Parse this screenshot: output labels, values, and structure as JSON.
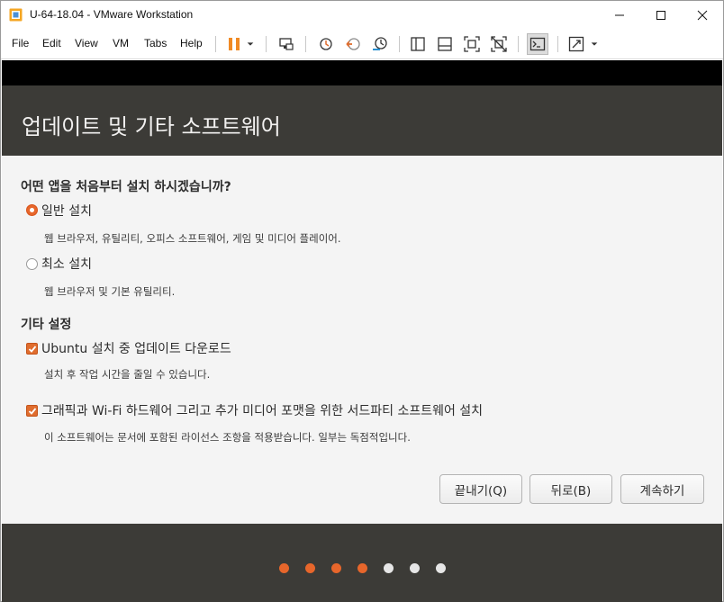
{
  "window": {
    "title": "U-64-18.04 - VMware Workstation"
  },
  "menu": {
    "items": [
      "File",
      "Edit",
      "View",
      "VM",
      "Tabs",
      "Help"
    ]
  },
  "toolbar": {
    "icons": [
      "pause-icon",
      "dropdown-arrow-icon",
      "send-ctrl-alt-del-icon",
      "snapshot-take-icon",
      "snapshot-revert-icon",
      "snapshot-manager-icon",
      "sidebar-library-icon",
      "thumbnail-bar-icon",
      "fullscreen-icon",
      "unity-icon",
      "console-view-icon",
      "stretch-guest-icon",
      "dropdown-arrow-icon"
    ]
  },
  "installer": {
    "title": "업데이트 및 기타 소프트웨어",
    "question": "어떤 앱을 처음부터 설치 하시겠습니까?",
    "options": [
      {
        "label": "일반 설치",
        "description": "웹 브라우저, 유틸리티, 오피스  소프트웨어, 게임 및 미디어 플레이어.",
        "selected": true
      },
      {
        "label": "최소 설치",
        "description": "웹 브라우저 및 기본 유틸리티.",
        "selected": false
      }
    ],
    "other_settings_title": "기타 설정",
    "checkboxes": [
      {
        "label": "Ubuntu 설치 중 업데이트 다운로드",
        "description": "설치 후 작업 시간을 줄일 수 있습니다.",
        "checked": true
      },
      {
        "label": "그래픽과 Wi-Fi 하드웨어 그리고 추가 미디어 포맷을 위한 서드파티 소프트웨어 설치",
        "description": "이 소프트웨어는 문서에 포함된 라이선스 조항을 적용받습니다. 일부는 독점적입니다.",
        "checked": true
      }
    ],
    "buttons": {
      "quit": "끝내기(Q)",
      "back": "뒤로(B)",
      "continue": "계속하기"
    },
    "progress": {
      "total_steps": 7,
      "completed_steps": 4
    }
  },
  "colors": {
    "accent": "#e7662b",
    "header_bg": "#3c3b37",
    "body_bg": "#f4f4f4",
    "dot_done": "#e7662b",
    "dot_todo": "#e6e6e6"
  }
}
